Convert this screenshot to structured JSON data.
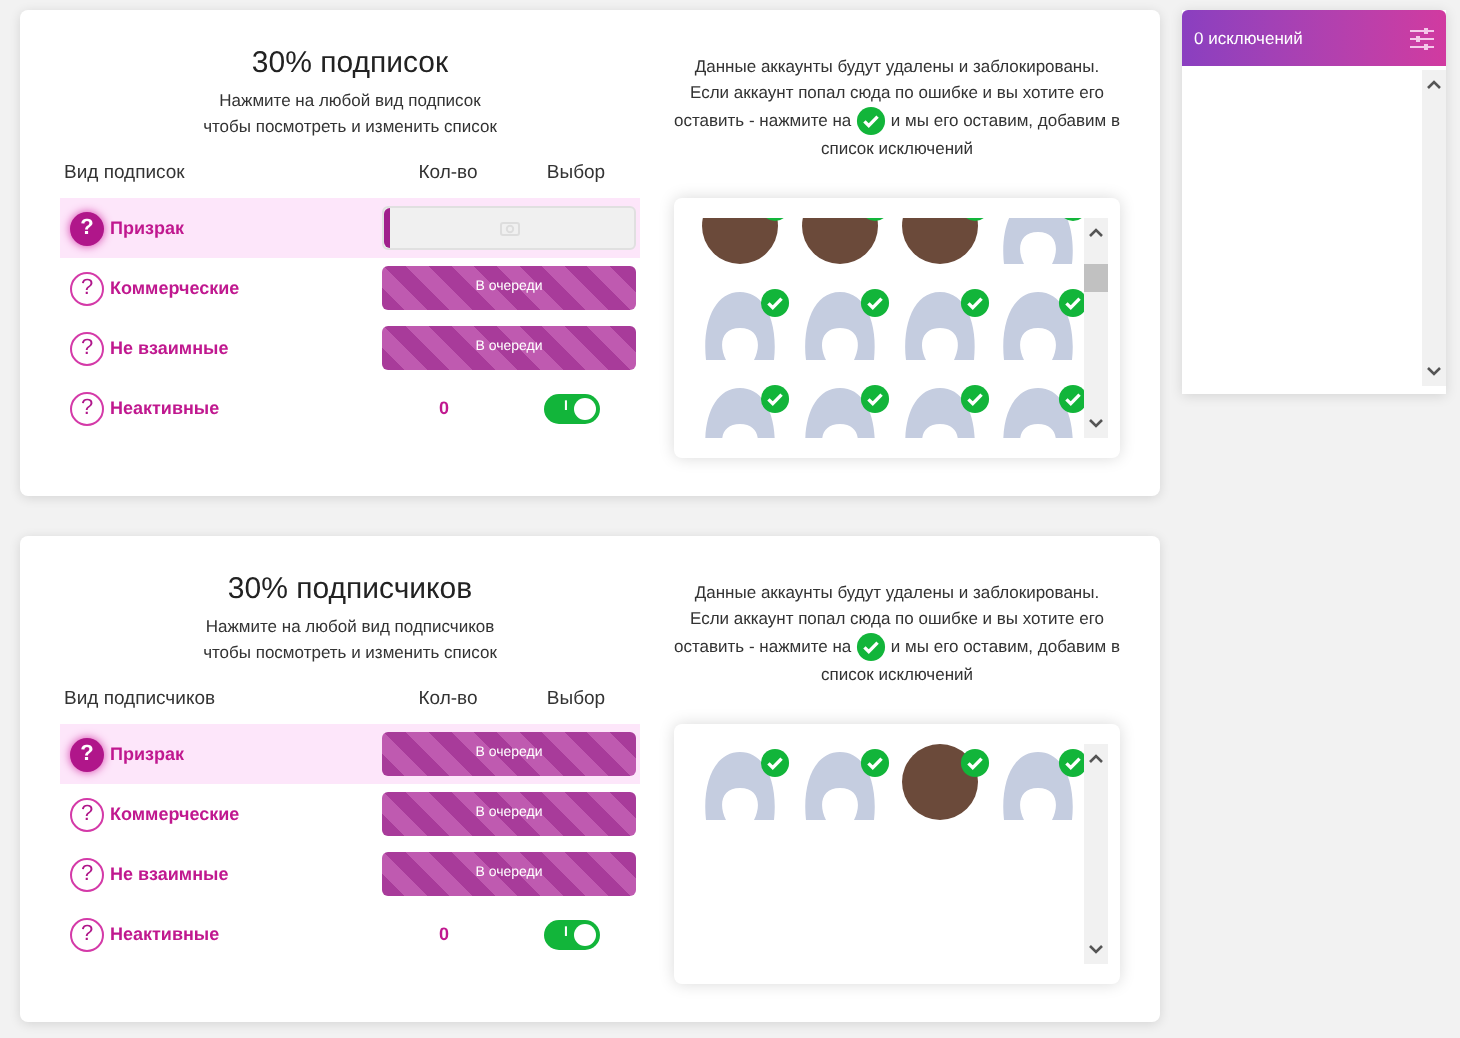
{
  "sections": [
    {
      "title": "30% подписок",
      "hint": "Нажмите на любой вид подписок чтобы посмотреть и изменить список",
      "columns": [
        "Вид подписок",
        "Кол-во",
        "Выбор"
      ],
      "rows": [
        {
          "icon_text": "?",
          "label": "Призрак",
          "selected": true,
          "kind": "progress",
          "level": 0.02
        },
        {
          "icon_text": "?",
          "label": "Коммерческие",
          "selected": false,
          "kind": "queue",
          "status": "В очереди"
        },
        {
          "icon_text": "?",
          "label": "Не взаимные",
          "selected": false,
          "kind": "queue",
          "status": "В очереди"
        },
        {
          "icon_text": "?",
          "label": "Неактивные",
          "selected": false,
          "kind": "toggle",
          "count": "0",
          "on": true,
          "switch_text": "I"
        }
      ],
      "info_before": "Данные аккаунты будут удалены и заблокированы. Если аккаунт попал сюда по ошибке и вы хотите его оставить - нажмите на",
      "info_after": "и мы его оставим, добавим в список исключений",
      "avatars_scrolled": true,
      "avatars": [
        {
          "kind": "photo",
          "checked": true
        },
        {
          "kind": "photo",
          "checked": true
        },
        {
          "kind": "photo",
          "checked": true
        },
        {
          "kind": "placeholder",
          "checked": true
        },
        {
          "kind": "placeholder",
          "checked": true
        },
        {
          "kind": "placeholder",
          "checked": true
        },
        {
          "kind": "placeholder",
          "checked": true
        },
        {
          "kind": "placeholder",
          "checked": true
        },
        {
          "kind": "placeholder",
          "checked": true
        },
        {
          "kind": "placeholder",
          "checked": true
        },
        {
          "kind": "placeholder",
          "checked": true
        },
        {
          "kind": "placeholder",
          "checked": true
        }
      ]
    },
    {
      "title": "30% подписчиков",
      "hint": "Нажмите на любой вид подписчиков чтобы посмотреть и изменить список",
      "columns": [
        "Вид подписчиков",
        "Кол-во",
        "Выбор"
      ],
      "rows": [
        {
          "icon_text": "?",
          "label": "Призрак",
          "selected": true,
          "kind": "queue",
          "status": "В очереди"
        },
        {
          "icon_text": "?",
          "label": "Коммерческие",
          "selected": false,
          "kind": "queue",
          "status": "В очереди"
        },
        {
          "icon_text": "?",
          "label": "Не взаимные",
          "selected": false,
          "kind": "queue",
          "status": "В очереди"
        },
        {
          "icon_text": "?",
          "label": "Неактивные",
          "selected": false,
          "kind": "toggle",
          "count": "0",
          "on": true,
          "switch_text": "I"
        }
      ],
      "info_before": "Данные аккаунты будут удалены и заблокированы. Если аккаунт попал сюда по ошибке и вы хотите его оставить - нажмите на",
      "info_after": "и мы его оставим, добавим в список исключений",
      "avatars_scrolled": false,
      "avatars": [
        {
          "kind": "placeholder",
          "checked": true
        },
        {
          "kind": "placeholder",
          "checked": true
        },
        {
          "kind": "photo",
          "checked": true
        },
        {
          "kind": "placeholder",
          "checked": true
        }
      ]
    }
  ],
  "exceptions": {
    "title": "0 исключений"
  }
}
